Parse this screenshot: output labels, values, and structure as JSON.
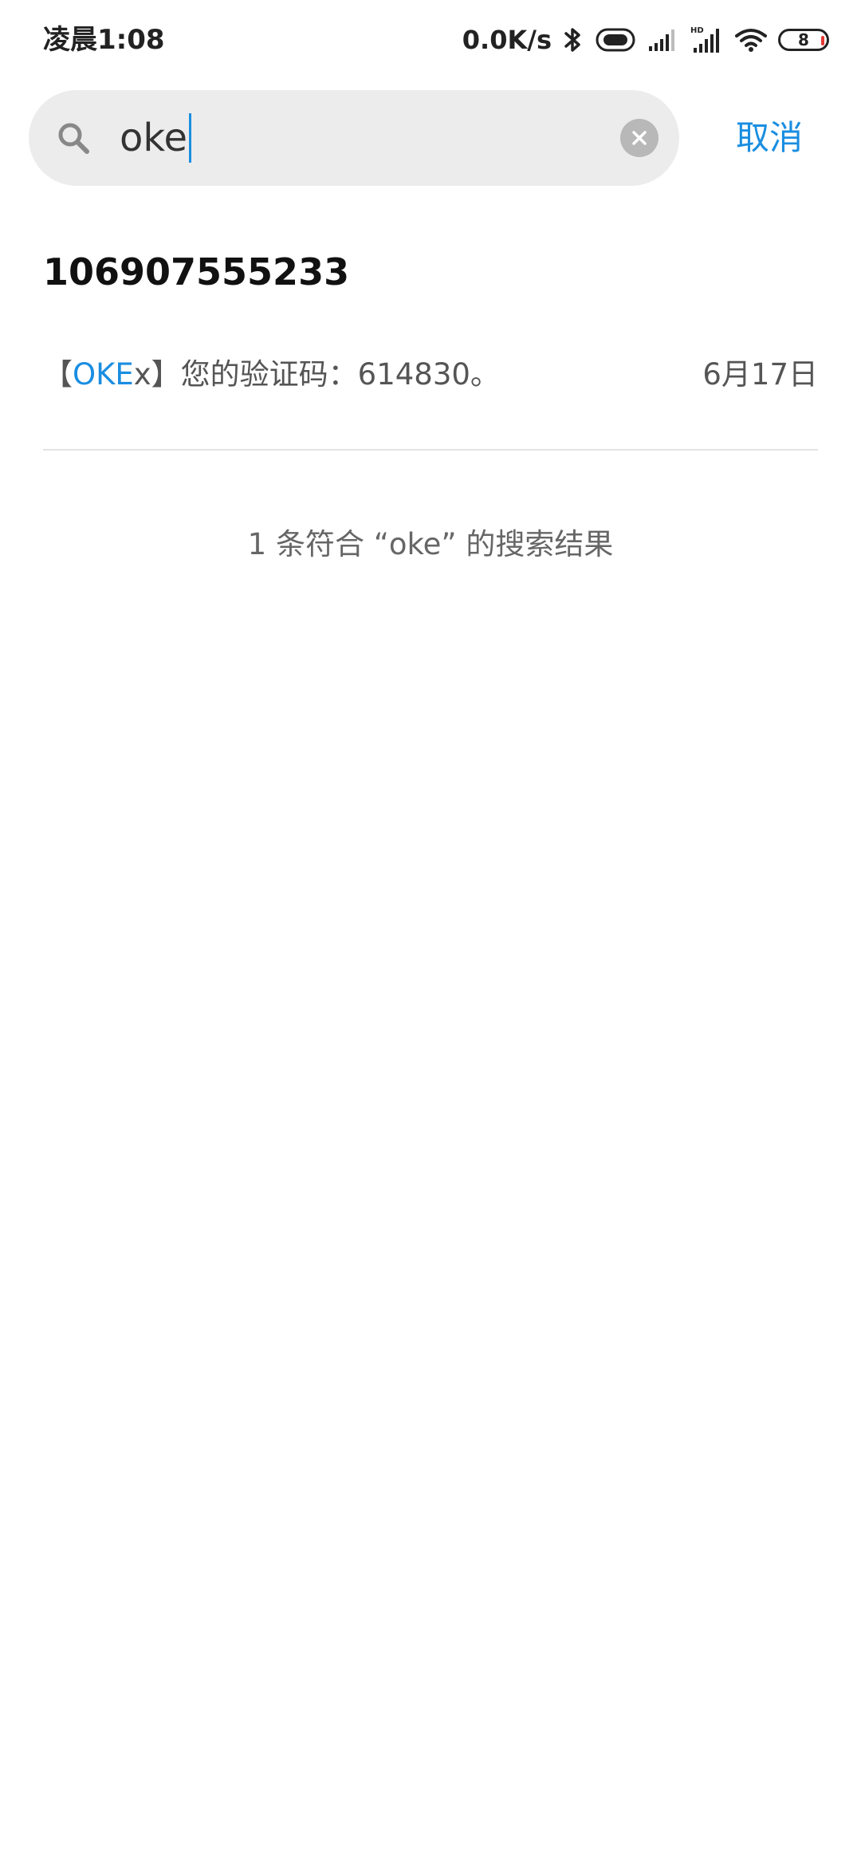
{
  "status_bar": {
    "time": "凌晨1:08",
    "net_speed": "0.0K/s",
    "hd_label": "HD",
    "battery_level": "8",
    "icons": [
      "bluetooth-icon",
      "vibrate-icon",
      "signal-icon",
      "signal-hd-icon",
      "wifi-icon",
      "battery-icon"
    ]
  },
  "search": {
    "value": "oke",
    "cancel_label": "取消"
  },
  "result": {
    "sender": "106907555233",
    "message": {
      "prefix": "【",
      "highlight": "OKE",
      "suffix": "x】您的验证码：614830。"
    },
    "date": "6月17日"
  },
  "result_count": "1 条符合 “oke” 的搜索结果",
  "colors": {
    "accent": "#1a8ee1",
    "search_bg": "#ececec",
    "text_secondary": "#555555"
  }
}
